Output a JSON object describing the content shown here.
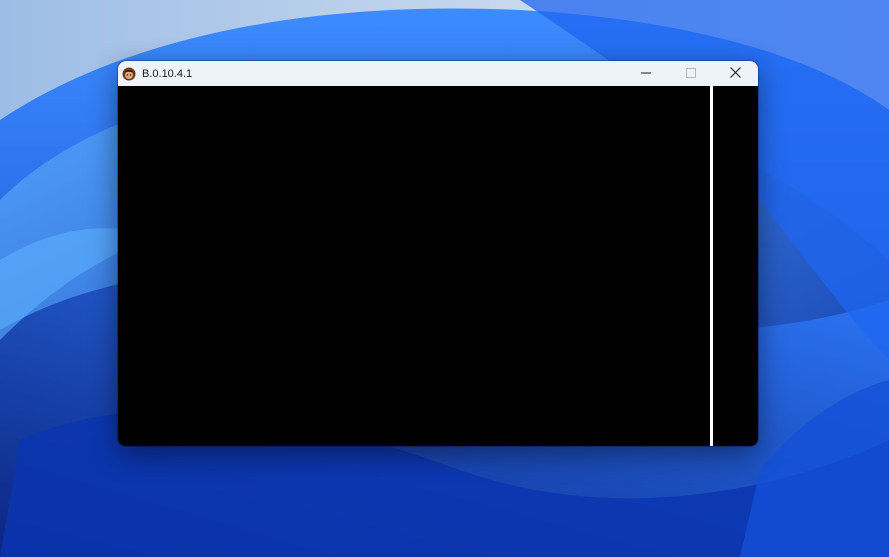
{
  "window": {
    "title": "B.0.10.4.1",
    "icon": "app-character-icon",
    "controls": {
      "minimize": "minimize-icon",
      "maximize": "maximize-icon",
      "close": "close-icon"
    }
  },
  "colors": {
    "titlebar": "#eef2f9",
    "client_background": "#000000",
    "divider": "#ffffff",
    "wallpaper_accent": "#1a5fe0"
  }
}
